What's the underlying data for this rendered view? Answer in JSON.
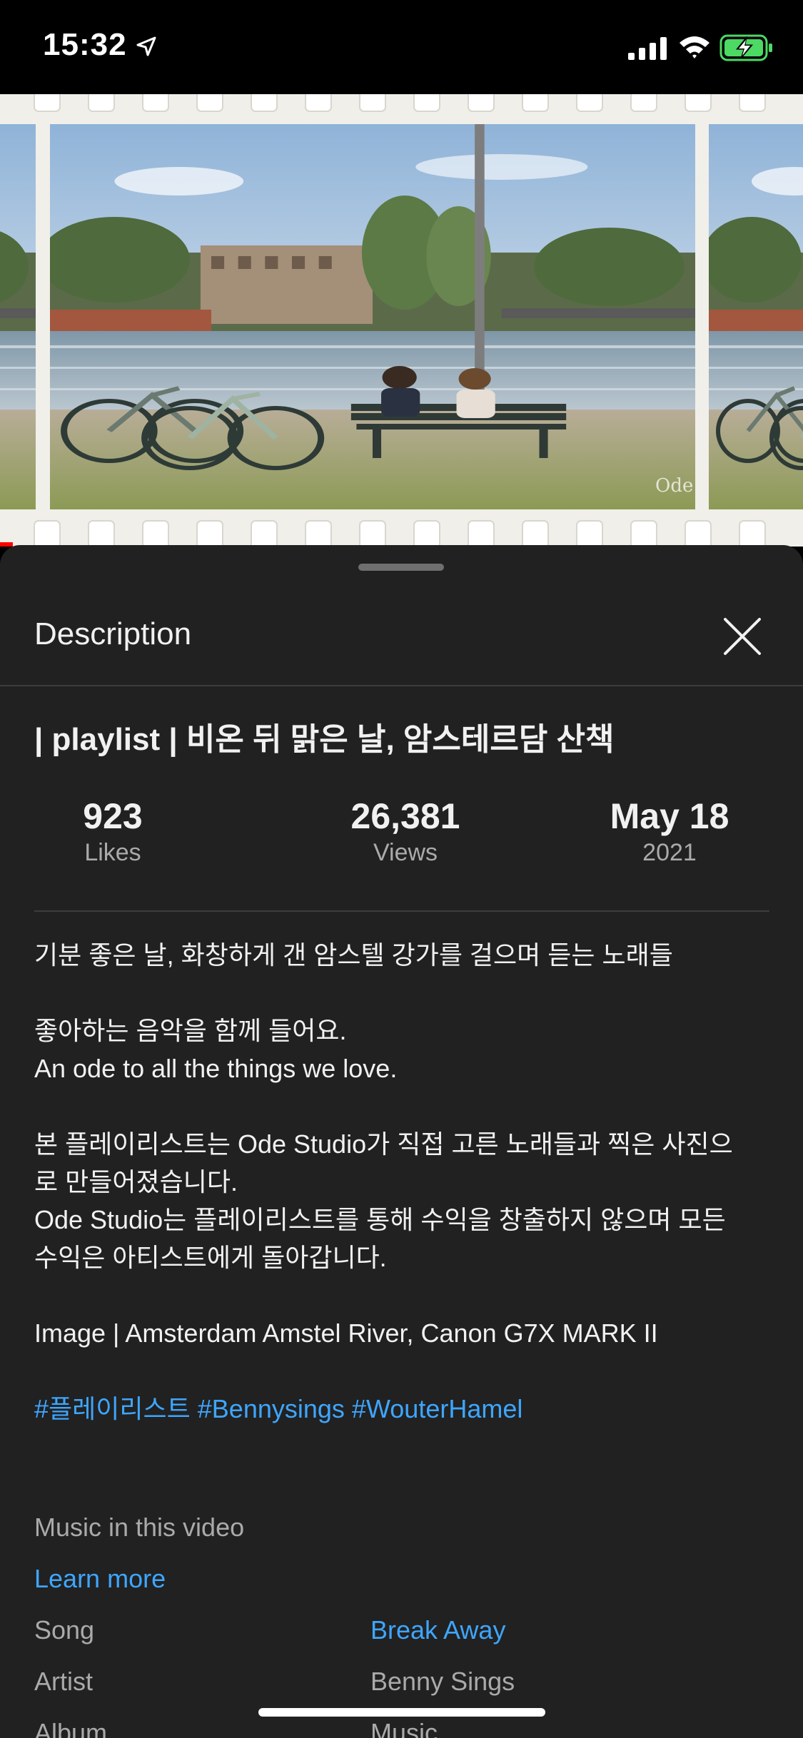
{
  "status_bar": {
    "time": "15:32",
    "icons": [
      "location-arrow-icon",
      "cellular-signal-icon",
      "wifi-icon",
      "battery-charging-icon"
    ],
    "battery_color": "#4cd964"
  },
  "video": {
    "watermark": "Ode"
  },
  "sheet": {
    "title": "Description",
    "close_icon": "close-icon"
  },
  "video_info": {
    "title": "| playlist | 비온 뒤 맑은 날, 암스테르담 산책",
    "stats": [
      {
        "value": "923",
        "label": "Likes"
      },
      {
        "value": "26,381",
        "label": "Views"
      },
      {
        "value": "May 18",
        "label": "2021"
      }
    ]
  },
  "description": {
    "lines": [
      "기분 좋은 날, 화창하게 갠 암스텔 강가를 걸으며 듣는 노래들",
      "좋아하는 음악을 함께 들어요.",
      "An ode to all the things we love.",
      "본 플레이리스트는 Ode Studio가 직접 고른 노래들과 찍은 사진으",
      "로 만들어졌습니다.",
      "Ode Studio는 플레이리스트를 통해 수익을 창출하지 않으며 모든",
      "수익은 아티스트에게 돌아갑니다.",
      "Image | Amsterdam Amstel River, Canon G7X MARK II"
    ],
    "hashtags": [
      "#플레이리스트",
      "#Bennysings",
      "#WouterHamel"
    ],
    "link_color": "#3ea6ff"
  },
  "music": {
    "heading": "Music in this video",
    "learn_more": "Learn more",
    "rows": [
      {
        "label": "Song",
        "value": "Break Away"
      },
      {
        "label": "Artist",
        "value": "Benny Sings"
      },
      {
        "label": "Album",
        "value": "Music"
      }
    ]
  }
}
